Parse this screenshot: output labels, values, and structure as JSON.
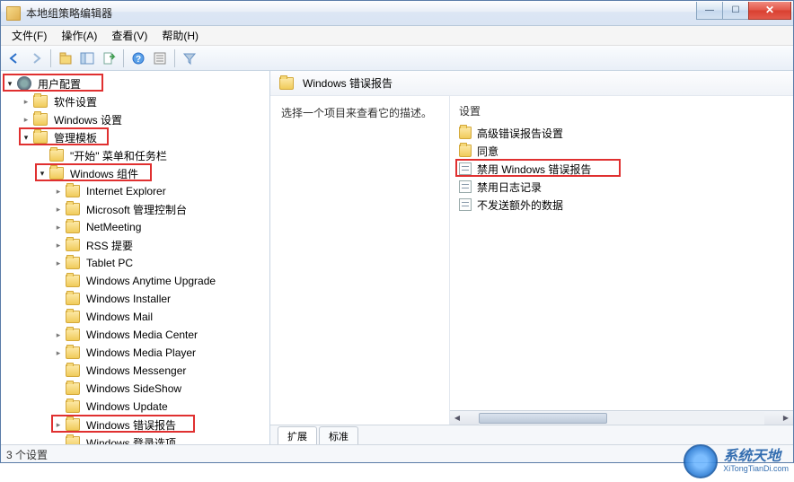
{
  "window": {
    "title": "本地组策略编辑器"
  },
  "menubar": [
    "文件(F)",
    "操作(A)",
    "查看(V)",
    "帮助(H)"
  ],
  "toolbar_icons": [
    "back",
    "forward",
    "sep",
    "up",
    "home",
    "refresh",
    "sep",
    "help",
    "props",
    "sep",
    "filter"
  ],
  "tree": [
    {
      "depth": 0,
      "expander": "open",
      "icon": "gear",
      "label": "用户配置",
      "hl": true
    },
    {
      "depth": 1,
      "expander": "closed",
      "icon": "folder",
      "label": "软件设置"
    },
    {
      "depth": 1,
      "expander": "closed",
      "icon": "folder",
      "label": "Windows 设置"
    },
    {
      "depth": 1,
      "expander": "open",
      "icon": "folder",
      "label": "管理模板",
      "hl": true
    },
    {
      "depth": 2,
      "expander": "none",
      "icon": "folder",
      "label": "\"开始\" 菜单和任务栏"
    },
    {
      "depth": 2,
      "expander": "open",
      "icon": "folder",
      "label": "Windows 组件",
      "hl": true
    },
    {
      "depth": 3,
      "expander": "closed",
      "icon": "folder",
      "label": "Internet Explorer"
    },
    {
      "depth": 3,
      "expander": "closed",
      "icon": "folder",
      "label": "Microsoft 管理控制台"
    },
    {
      "depth": 3,
      "expander": "closed",
      "icon": "folder",
      "label": "NetMeeting"
    },
    {
      "depth": 3,
      "expander": "closed",
      "icon": "folder",
      "label": "RSS 提要"
    },
    {
      "depth": 3,
      "expander": "closed",
      "icon": "folder",
      "label": "Tablet PC"
    },
    {
      "depth": 3,
      "expander": "none",
      "icon": "folder",
      "label": "Windows Anytime Upgrade"
    },
    {
      "depth": 3,
      "expander": "none",
      "icon": "folder",
      "label": "Windows Installer"
    },
    {
      "depth": 3,
      "expander": "none",
      "icon": "folder",
      "label": "Windows Mail"
    },
    {
      "depth": 3,
      "expander": "closed",
      "icon": "folder",
      "label": "Windows Media Center"
    },
    {
      "depth": 3,
      "expander": "closed",
      "icon": "folder",
      "label": "Windows Media Player"
    },
    {
      "depth": 3,
      "expander": "none",
      "icon": "folder",
      "label": "Windows Messenger"
    },
    {
      "depth": 3,
      "expander": "none",
      "icon": "folder",
      "label": "Windows SideShow"
    },
    {
      "depth": 3,
      "expander": "none",
      "icon": "folder",
      "label": "Windows Update"
    },
    {
      "depth": 3,
      "expander": "closed",
      "icon": "folder",
      "label": "Windows 错误报告",
      "hl": true
    },
    {
      "depth": 3,
      "expander": "none",
      "icon": "folder",
      "label": "Windows 登录选项"
    }
  ],
  "right": {
    "header": "Windows 错误报告",
    "desc_prompt": "选择一个项目来查看它的描述。",
    "list_header": "设置",
    "items": [
      {
        "icon": "folder",
        "label": "高级错误报告设置"
      },
      {
        "icon": "folder",
        "label": "同意"
      },
      {
        "icon": "setting",
        "label": "禁用 Windows 错误报告",
        "hl": true
      },
      {
        "icon": "setting",
        "label": "禁用日志记录"
      },
      {
        "icon": "setting",
        "label": "不发送额外的数据"
      }
    ],
    "tabs": {
      "extended": "扩展",
      "standard": "标准",
      "active": "extended"
    }
  },
  "statusbar": "3 个设置",
  "watermark": {
    "brand": "系统天地",
    "url": "XiTongTianDi.com"
  }
}
